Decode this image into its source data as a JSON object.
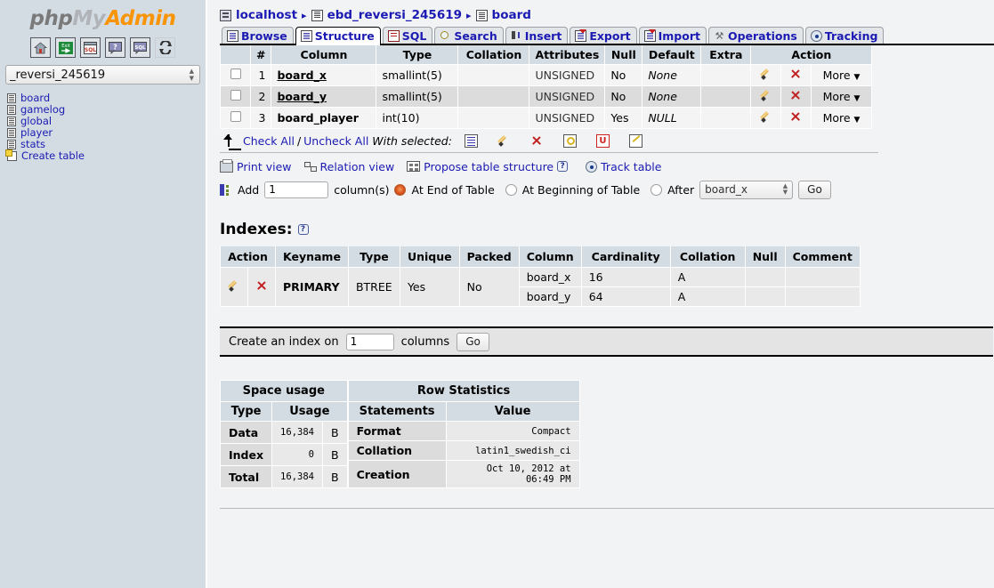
{
  "sidebar": {
    "logo": {
      "php": "php",
      "my": "My",
      "admin": "Admin"
    },
    "nav_buttons": [
      {
        "name": "home-icon",
        "title": "Home"
      },
      {
        "name": "exit-icon",
        "title": "Log out"
      },
      {
        "name": "sql-window-icon",
        "title": "Query window"
      },
      {
        "name": "phpmyadmin-docs-icon",
        "title": "phpMyAdmin documentation"
      },
      {
        "name": "sql-docs-icon",
        "title": "MySQL documentation"
      },
      {
        "name": "reload-icon",
        "title": "Reload navigation frame"
      }
    ],
    "db_select": {
      "value": "_reversi_245619"
    },
    "tables": [
      {
        "label": "board"
      },
      {
        "label": "gamelog"
      },
      {
        "label": "global"
      },
      {
        "label": "player"
      },
      {
        "label": "stats"
      }
    ],
    "create_table": "Create table"
  },
  "breadcrumb": {
    "server": "localhost",
    "database": "ebd_reversi_245619",
    "table": "board",
    "separator": "▸"
  },
  "tabs": [
    {
      "label": "Browse",
      "icon": "browse-icon",
      "active": false
    },
    {
      "label": "Structure",
      "icon": "structure-icon",
      "active": true
    },
    {
      "label": "SQL",
      "icon": "sql-icon",
      "active": false
    },
    {
      "label": "Search",
      "icon": "search-icon",
      "active": false
    },
    {
      "label": "Insert",
      "icon": "insert-icon",
      "active": false
    },
    {
      "label": "Export",
      "icon": "export-icon",
      "active": false
    },
    {
      "label": "Import",
      "icon": "import-icon",
      "active": false
    },
    {
      "label": "Operations",
      "icon": "operations-icon",
      "active": false
    },
    {
      "label": "Tracking",
      "icon": "tracking-icon",
      "active": false
    }
  ],
  "structure": {
    "headers": [
      "",
      "#",
      "Column",
      "Type",
      "Collation",
      "Attributes",
      "Null",
      "Default",
      "Extra",
      "Action"
    ],
    "rows": [
      {
        "num": "1",
        "column": "board_x",
        "type": "smallint(5)",
        "collation": "",
        "attributes": "UNSIGNED",
        "null": "No",
        "default": "None",
        "extra": "",
        "primary": true,
        "more": "More"
      },
      {
        "num": "2",
        "column": "board_y",
        "type": "smallint(5)",
        "collation": "",
        "attributes": "UNSIGNED",
        "null": "No",
        "default": "None",
        "extra": "",
        "primary": true,
        "more": "More"
      },
      {
        "num": "3",
        "column": "board_player",
        "type": "int(10)",
        "collation": "",
        "attributes": "UNSIGNED",
        "null": "Yes",
        "default": "NULL",
        "extra": "",
        "primary": false,
        "more": "More"
      }
    ],
    "with_selected": {
      "check_all": "Check All",
      "slash": "/",
      "uncheck_all": "Uncheck All",
      "label": "With selected:",
      "icons": [
        "browse-icon",
        "change-icon",
        "drop-icon",
        "primary-key-icon",
        "unique-icon",
        "index-icon"
      ]
    },
    "links": {
      "print_view": "Print view",
      "relation_view": "Relation view",
      "propose_table_structure": "Propose table structure",
      "help": "?",
      "track_table": "Track table"
    },
    "add_row": {
      "add_label": "Add",
      "count_value": "1",
      "columns_label": "column(s)",
      "at_end": "At End of Table",
      "at_beginning": "At Beginning of Table",
      "after": "After",
      "after_value": "board_x",
      "go": "Go",
      "selected": "at_end"
    }
  },
  "indexes": {
    "title": "Indexes:",
    "help": "?",
    "headers": [
      "Action",
      "",
      "Keyname",
      "Type",
      "Unique",
      "Packed",
      "Column",
      "Cardinality",
      "Collation",
      "Null",
      "Comment"
    ],
    "rows": [
      {
        "keyname": "PRIMARY",
        "type": "BTREE",
        "unique": "Yes",
        "packed": "No",
        "column": "board_x",
        "cardinality": "16",
        "collation": "A",
        "null": "",
        "comment": ""
      },
      {
        "keyname": "",
        "type": "",
        "unique": "",
        "packed": "",
        "column": "board_y",
        "cardinality": "64",
        "collation": "A",
        "null": "",
        "comment": ""
      }
    ],
    "create_index": {
      "label_before": "Create an index on",
      "value": "1",
      "label_after": "columns",
      "go": "Go"
    }
  },
  "space_usage": {
    "caption": "Space usage",
    "headers": [
      "Type",
      "Usage"
    ],
    "rows": [
      {
        "type": "Data",
        "usage": "16,384",
        "unit": "B"
      },
      {
        "type": "Index",
        "usage": "0",
        "unit": "B"
      },
      {
        "type": "Total",
        "usage": "16,384",
        "unit": "B"
      }
    ]
  },
  "row_statistics": {
    "caption": "Row Statistics",
    "headers": [
      "Statements",
      "Value"
    ],
    "rows": [
      {
        "statement": "Format",
        "value": "Compact"
      },
      {
        "statement": "Collation",
        "value": "latin1_swedish_ci"
      },
      {
        "statement": "Creation",
        "value": "Oct 10, 2012 at 06:49 PM"
      }
    ]
  },
  "colors": {
    "sidebar_bg": "#d3dce3",
    "link": "#1b1bb3",
    "accent_orange": "#f89406",
    "drop_red": "#c22020",
    "header_bg": "#d3dce3"
  }
}
